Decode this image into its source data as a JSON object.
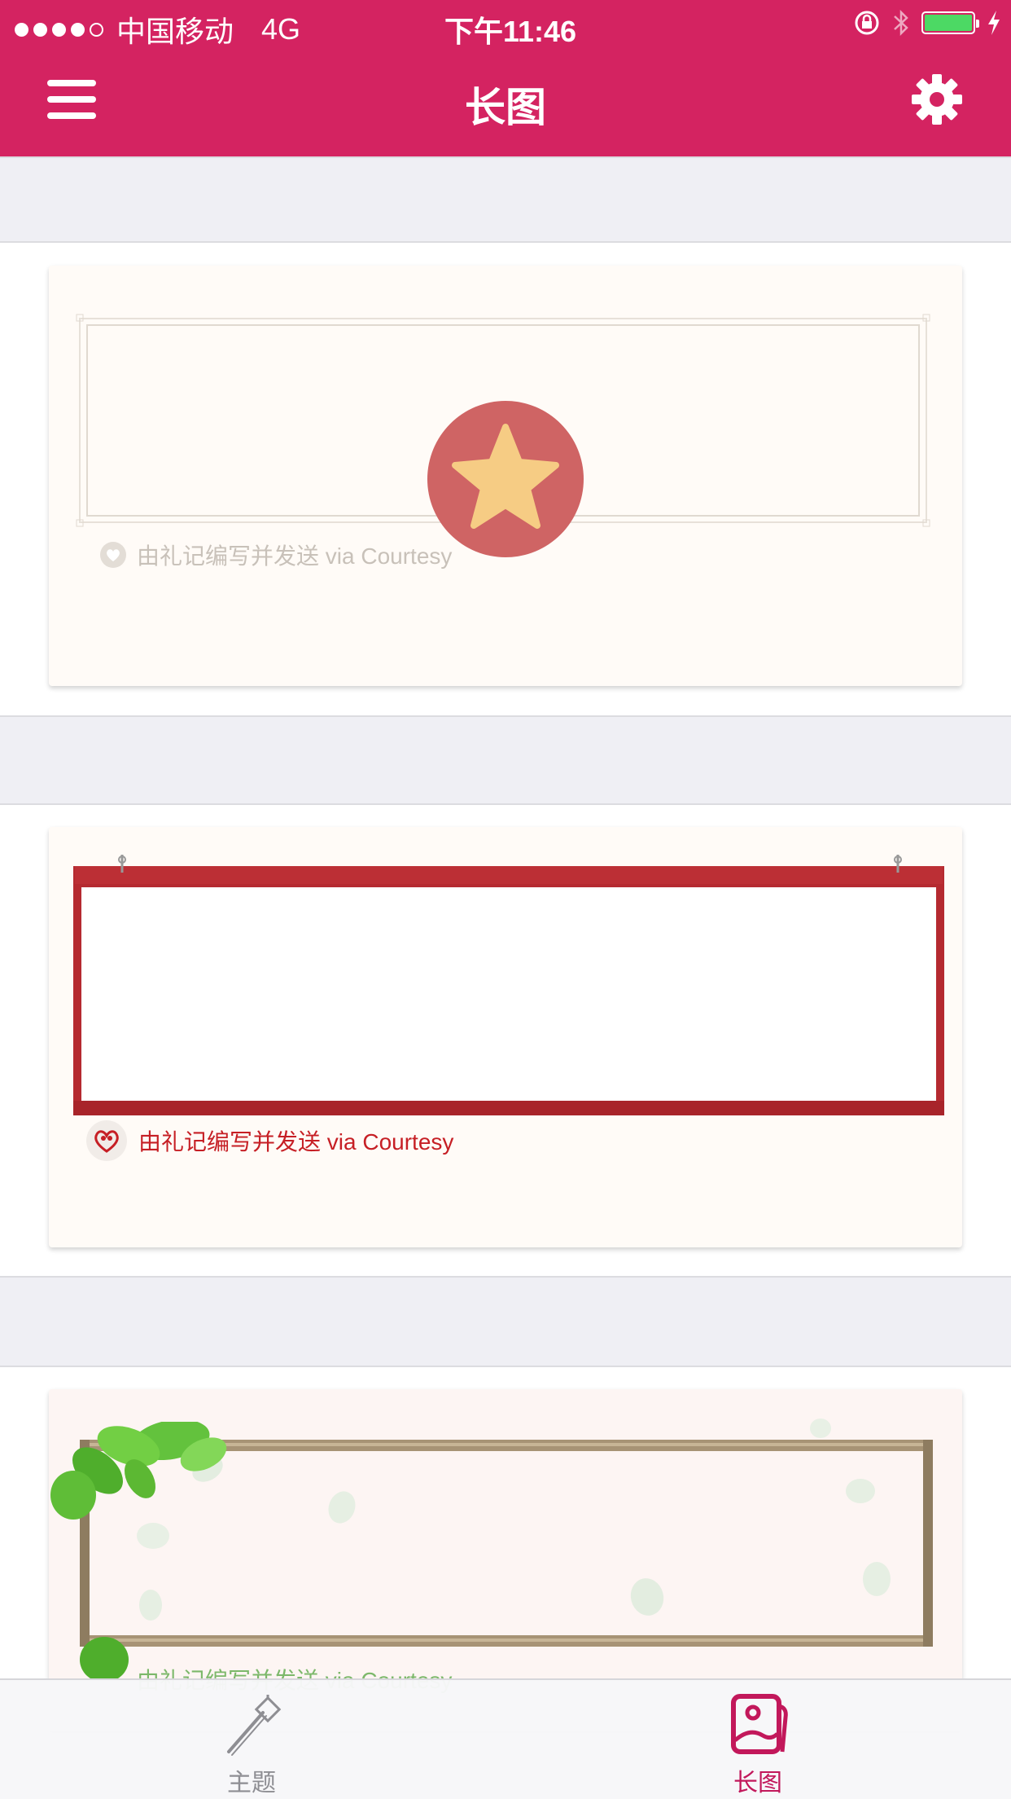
{
  "status_bar": {
    "carrier": "中国移动",
    "network": "4G",
    "time": "下午11:46",
    "signal_bars_filled": 4,
    "signal_bars_total": 5,
    "battery_level": 1.0,
    "battery_color": "#4cd964"
  },
  "header": {
    "title": "长图",
    "menu_icon": "hamburger-menu-icon",
    "settings_icon": "gear-icon",
    "background": "#d42361"
  },
  "templates": [
    {
      "credit": "由礼记编写并发送 via Courtesy",
      "style": "beige frame",
      "badge_icon": "star-icon"
    },
    {
      "credit": "由礼记编写并发送 via Courtesy",
      "style": "red hanging board"
    },
    {
      "credit": "由礼记编写并发送 via Courtesy",
      "style": "wooden frame with leaves"
    }
  ],
  "tab_bar": {
    "tabs": [
      {
        "label": "主题",
        "icon": "magic-wand-icon",
        "active": false
      },
      {
        "label": "长图",
        "icon": "photo-gallery-icon",
        "active": true
      }
    ],
    "active_color": "#c2185b",
    "inactive_color": "#8e8e93"
  }
}
